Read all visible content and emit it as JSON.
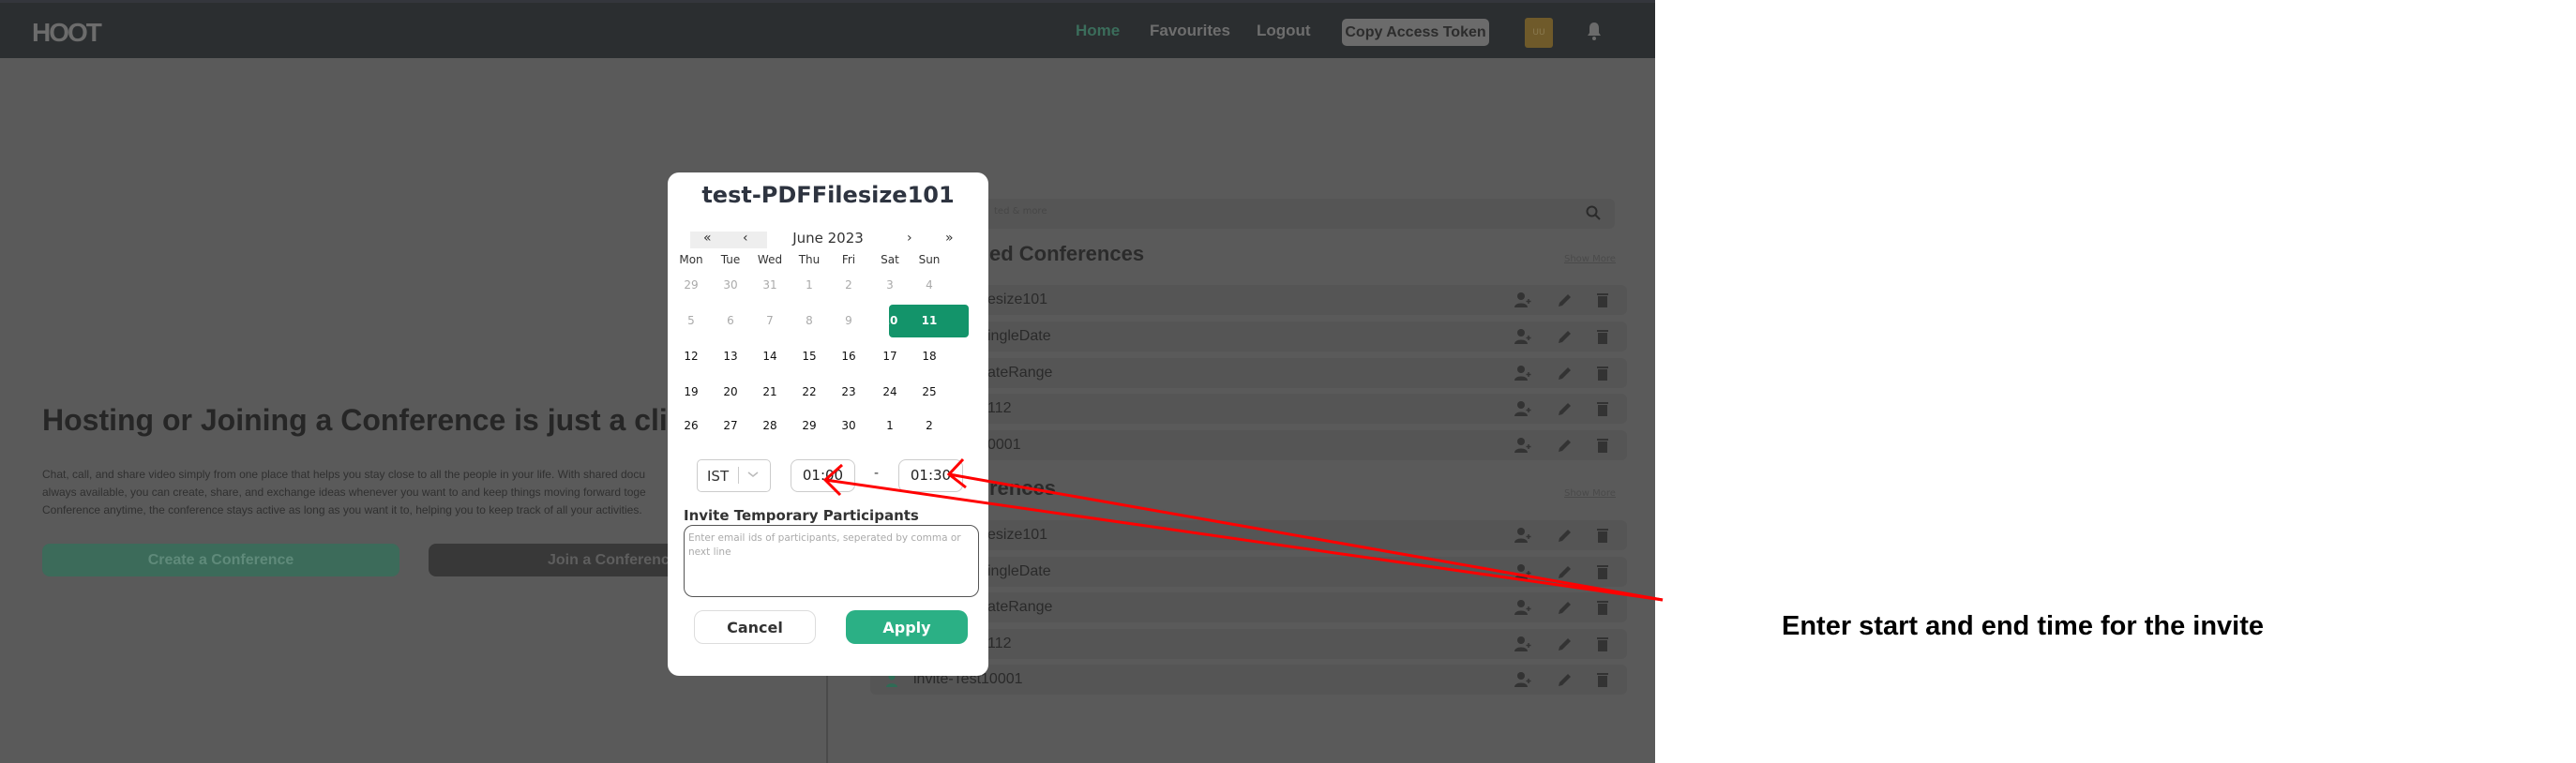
{
  "header": {
    "logo": "HOOT",
    "nav": [
      "Home",
      "Favourites",
      "Logout"
    ],
    "copy_token": "Copy Access Token",
    "avatar": "UU",
    "bell_icon": "bell-icon"
  },
  "hero": {
    "title": "Hosting or Joining a Conference is just a click",
    "paragraph": [
      "Chat, call, and share video simply from one place that helps you stay close to all the people in your life. With shared docu",
      "always available, you can create, share, and exchange ideas whenever you want to and keep things moving forward toge",
      "Conference anytime, the conference stays active as long as you want it to, helping you to keep track of all your activities."
    ],
    "create": "Create a Conference",
    "join": "Join a Conference"
  },
  "panel": {
    "search_placeholder": "ted & more",
    "section1": {
      "title": "ed Conferences",
      "show_more": "Show More",
      "rows": [
        "esize101",
        "ingleDate",
        "ateRange",
        "112",
        "0001"
      ]
    },
    "section2": {
      "title": "rences",
      "show_more": "Show More",
      "rows": [
        "esize101",
        "ingleDate",
        "ateRange",
        "112",
        "invite-Test10001"
      ]
    }
  },
  "modal": {
    "title": "test-PDFFilesize101",
    "calendar": {
      "month": "June 2023",
      "prev_year": "«",
      "prev": "‹",
      "next": "›",
      "next_year": "»",
      "weekdays": [
        "Mon",
        "Tue",
        "Wed",
        "Thu",
        "Fri",
        "Sat",
        "Sun"
      ],
      "weeks": [
        [
          "29",
          "30",
          "31",
          "1",
          "2",
          "3",
          "4"
        ],
        [
          "5",
          "6",
          "7",
          "8",
          "9",
          "10",
          "11"
        ],
        [
          "12",
          "13",
          "14",
          "15",
          "16",
          "17",
          "18"
        ],
        [
          "19",
          "20",
          "21",
          "22",
          "23",
          "24",
          "25"
        ],
        [
          "26",
          "27",
          "28",
          "29",
          "30",
          "1",
          "2"
        ]
      ],
      "selected": [
        "10",
        "11"
      ],
      "accent": "#13946a"
    },
    "timezone": "IST",
    "start_time": "01:00",
    "end_time": "01:30",
    "separator": "-",
    "invite_label": "Invite Temporary Participants",
    "invite_placeholder": "Enter email ids of participants, seperated by comma or next line",
    "cancel": "Cancel",
    "apply": "Apply",
    "apply_color": "#2bb085"
  },
  "annotation": {
    "text": "Enter start and end time for the invite",
    "color": "#ff0000"
  }
}
